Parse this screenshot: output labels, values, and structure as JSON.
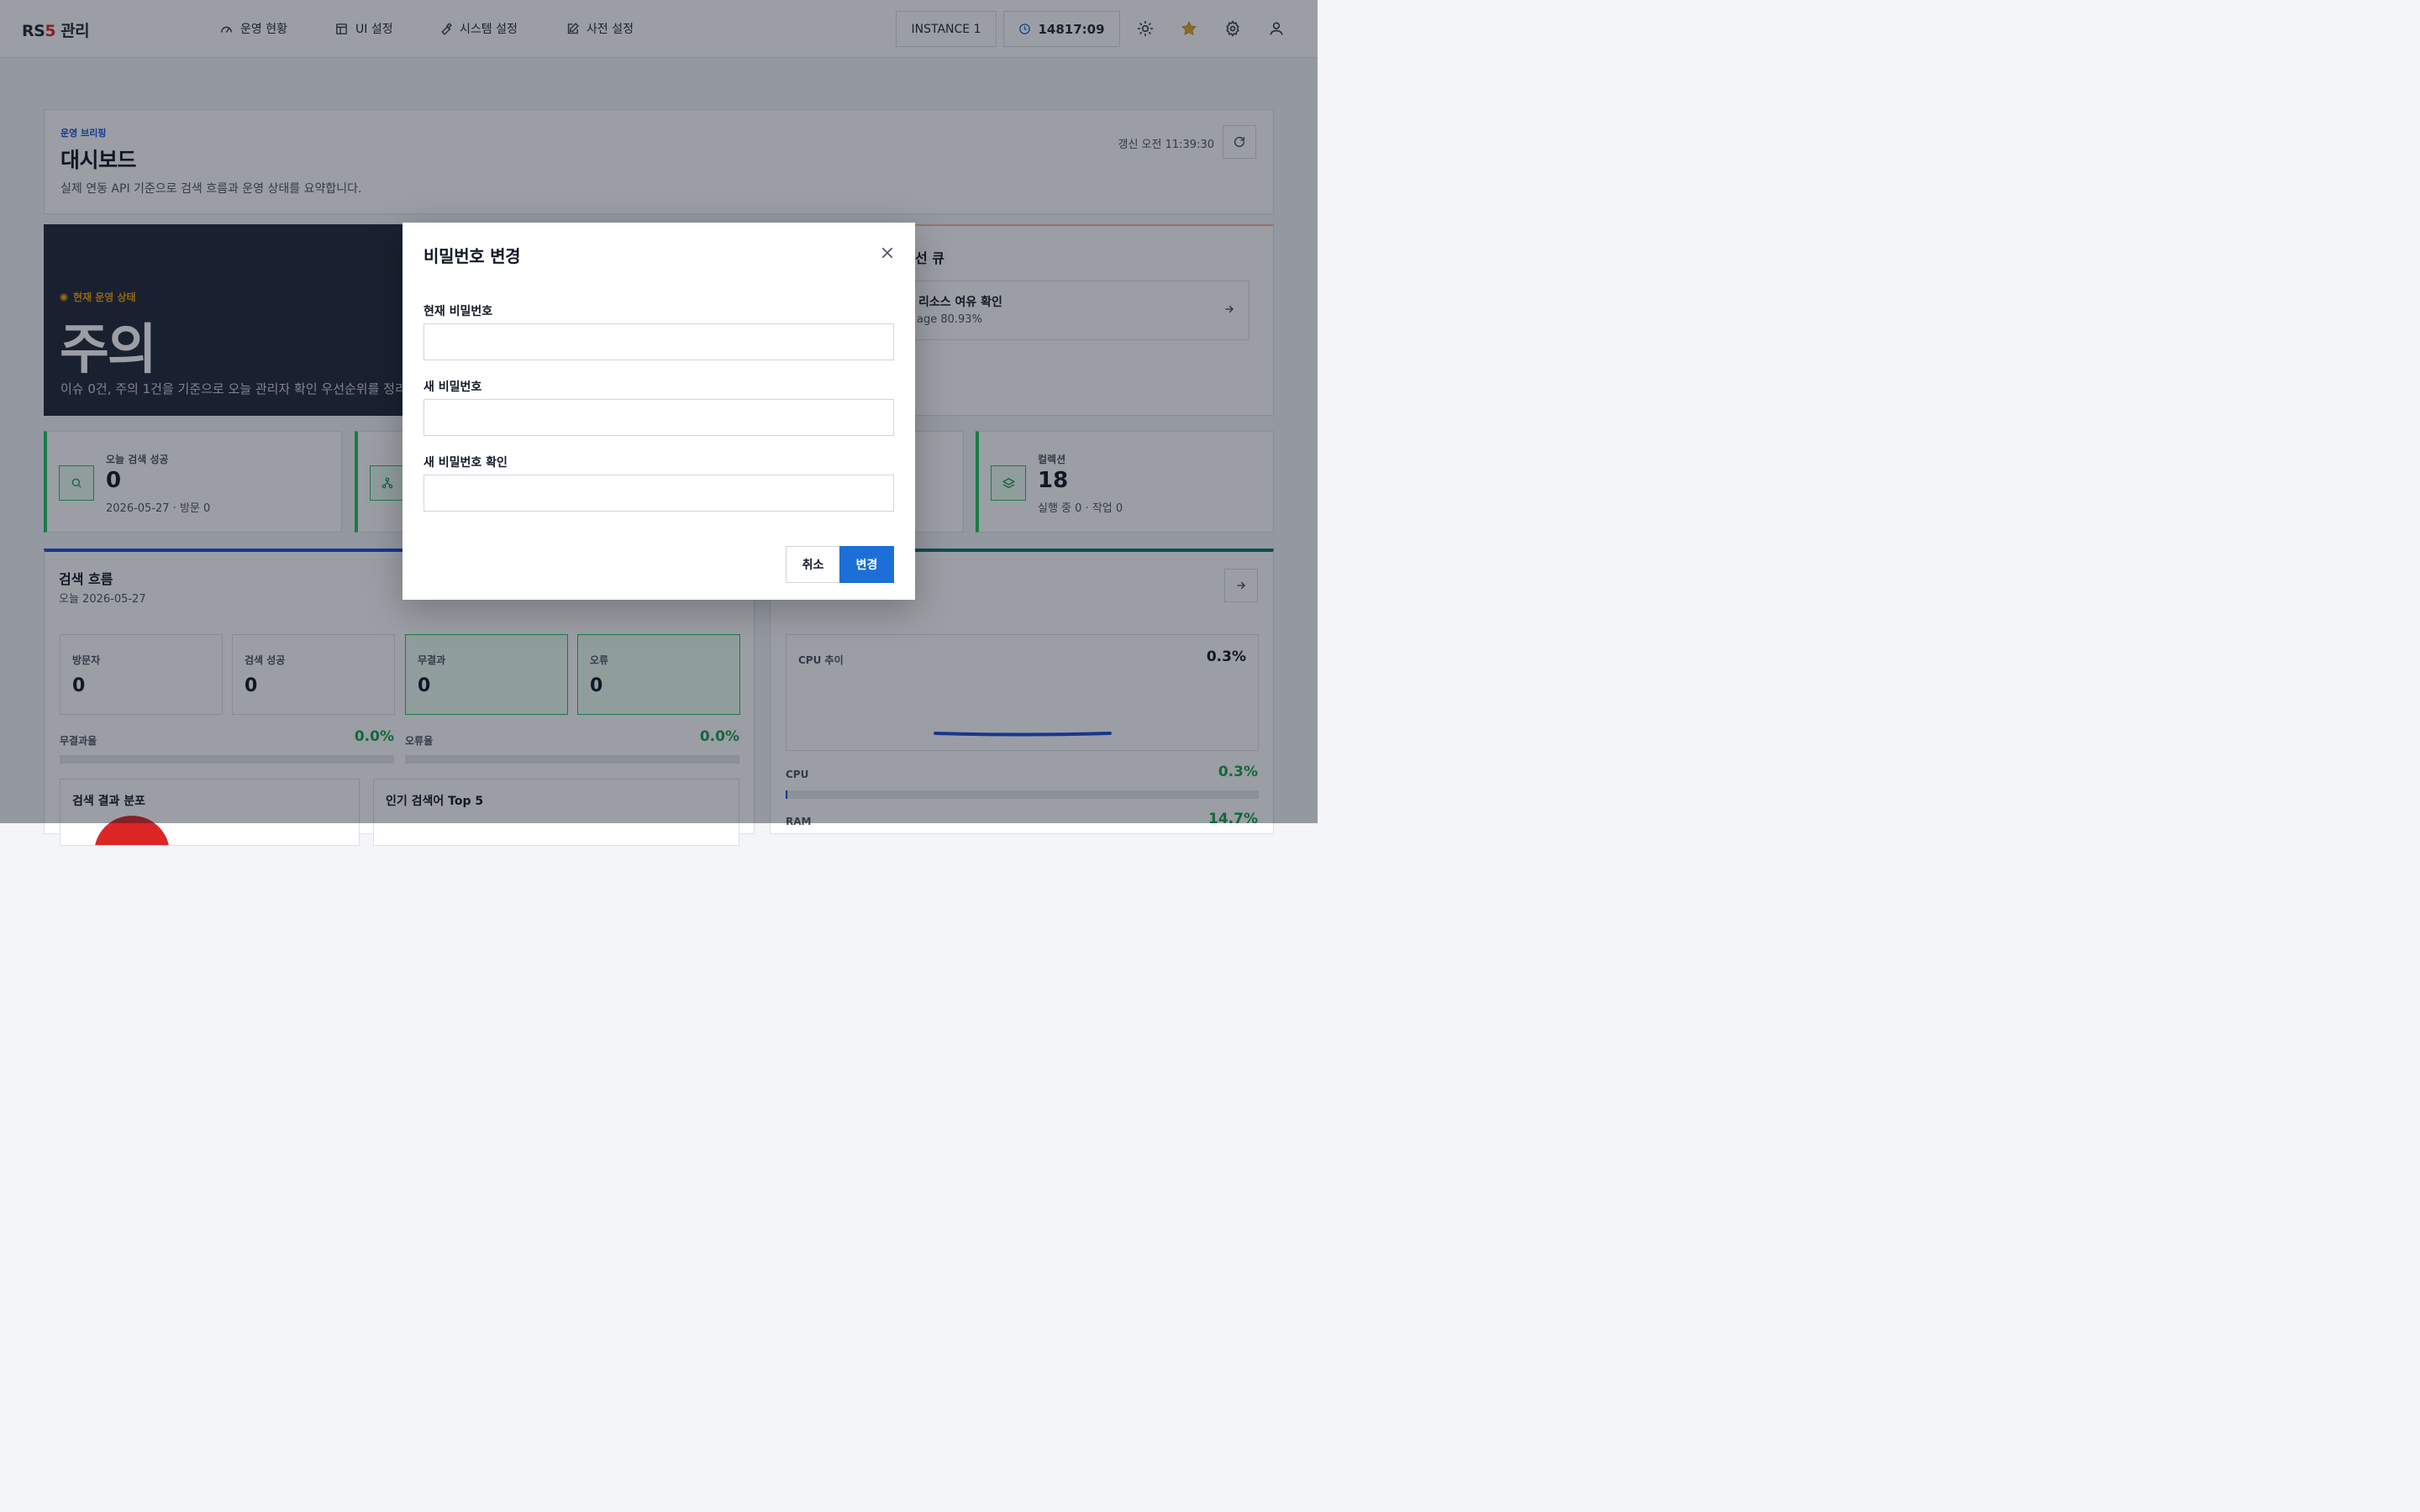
{
  "brand": {
    "prefix": "RS",
    "accent": "5",
    "suffix": " 관리"
  },
  "nav": [
    {
      "label": "운영 현황",
      "icon": "gauge-icon"
    },
    {
      "label": "UI 설정",
      "icon": "layout-icon"
    },
    {
      "label": "시스템 설정",
      "icon": "wrench-icon"
    },
    {
      "label": "사전 설정",
      "icon": "edit-icon"
    }
  ],
  "header": {
    "instance": "INSTANCE 1",
    "clock": "14817:09"
  },
  "briefing": {
    "kicker": "운영 브리핑",
    "title": "대시보드",
    "description": "실제 연동 API 기준으로 검색 흐름과 운영 상태를 요약합니다.",
    "refreshed": "갱신 오전 11:39:30"
  },
  "hero": {
    "kicker": "현재 운영 상태",
    "status": "주의",
    "description": "이슈 0건, 주의 1건을 기준으로 오늘 관리자 확인 우선순위를 정리합니다."
  },
  "queue": {
    "title": "선 큐",
    "item_title": "리소스 여유 확인",
    "item_sub": "age 80.93%"
  },
  "stats": [
    {
      "label": "오늘 검색 성공",
      "value": "0",
      "sub": "2026-05-27 · 방문 0",
      "icon": "search-icon"
    },
    {
      "label": "",
      "value": "",
      "sub": "",
      "icon": "network-icon"
    },
    {
      "label": "컬렉션",
      "value": "18",
      "sub": "실행 중 0 · 작업 0",
      "icon": "layers-icon"
    }
  ],
  "flow": {
    "title": "검색 흐름",
    "subtitle": "오늘 2026-05-27",
    "metrics": [
      {
        "label": "방문자",
        "value": "0"
      },
      {
        "label": "검색 성공",
        "value": "0"
      },
      {
        "label": "무결과",
        "value": "0"
      },
      {
        "label": "오류",
        "value": "0"
      }
    ],
    "no_result_rate_label": "무결과율",
    "no_result_rate": "0.0%",
    "error_rate_label": "오류율",
    "error_rate": "0.0%",
    "dist_title": "검색 결과 분포",
    "top_title": "인기 검색어 Top 5"
  },
  "system": {
    "cpu_trend_label": "CPU 추이",
    "cpu_trend_value": "0.3%",
    "cpu_label": "CPU",
    "cpu_value": "0.3%",
    "cpu_fraction": 0.003,
    "ram_label": "RAM",
    "ram_value": "14.7%"
  },
  "modal": {
    "title": "비밀번호 변경",
    "current_label": "현재 비밀번호",
    "current_value": "",
    "new_label": "새 비밀번호",
    "new_value": "",
    "confirm_label": "새 비밀번호 확인",
    "confirm_value": "",
    "cancel": "취소",
    "submit": "변경"
  },
  "colors": {
    "accent": "#1d6fd8",
    "success": "#16a34a",
    "warning": "#f59e0b",
    "danger": "#dc2626"
  }
}
